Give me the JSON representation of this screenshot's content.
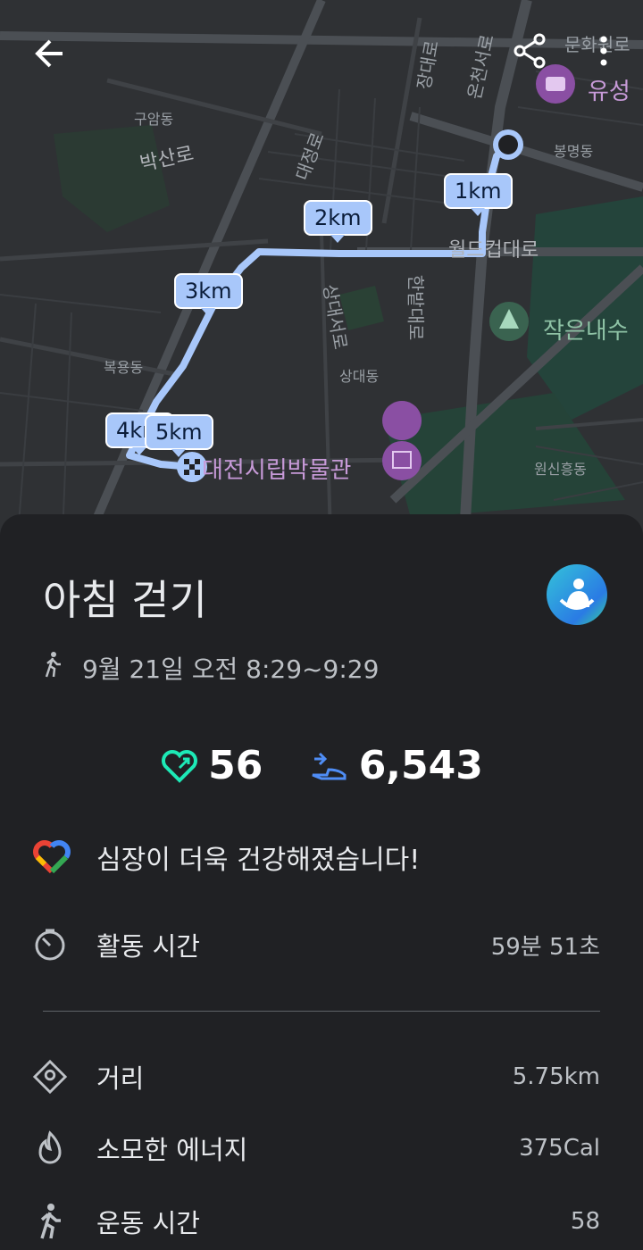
{
  "map": {
    "km_labels": [
      "1km",
      "2km",
      "3km",
      "4km",
      "5km"
    ],
    "street_labels": [
      "구암동",
      "박산로",
      "상대동",
      "복용동",
      "원신흥동",
      "봉명동",
      "월드컵대로",
      "한밭대로",
      "상대서로",
      "대정로",
      "장대로",
      "문화원로",
      "온천서로"
    ],
    "poi": {
      "museum": "대전시립박물관",
      "park": "작은내수",
      "camera": "유성"
    }
  },
  "toolbar": {
    "back_icon": "arrow-left-icon",
    "share_icon": "share-icon",
    "more_icon": "more-vert-icon"
  },
  "activity": {
    "title": "아침 걷기",
    "time_range": "9월 21일 오전 8:29~9:29",
    "heart_points": "56",
    "steps": "6,543",
    "message": "심장이 더욱 건강해졌습니다!"
  },
  "stats": [
    {
      "label": "활동 시간",
      "value": "59분 51초",
      "icon": "timer-icon"
    },
    {
      "label": "거리",
      "value": "5.75km",
      "icon": "location-diamond-icon"
    },
    {
      "label": "소모한 에너지",
      "value": "375Cal",
      "icon": "flame-icon"
    },
    {
      "label": "운동 시간",
      "value": "58",
      "icon": "walking-icon"
    }
  ],
  "colors": {
    "route": "#a8c7fa",
    "sheet_bg": "#202124",
    "heart_teal": "#1de9b6",
    "steps_blue": "#4f8df5"
  }
}
